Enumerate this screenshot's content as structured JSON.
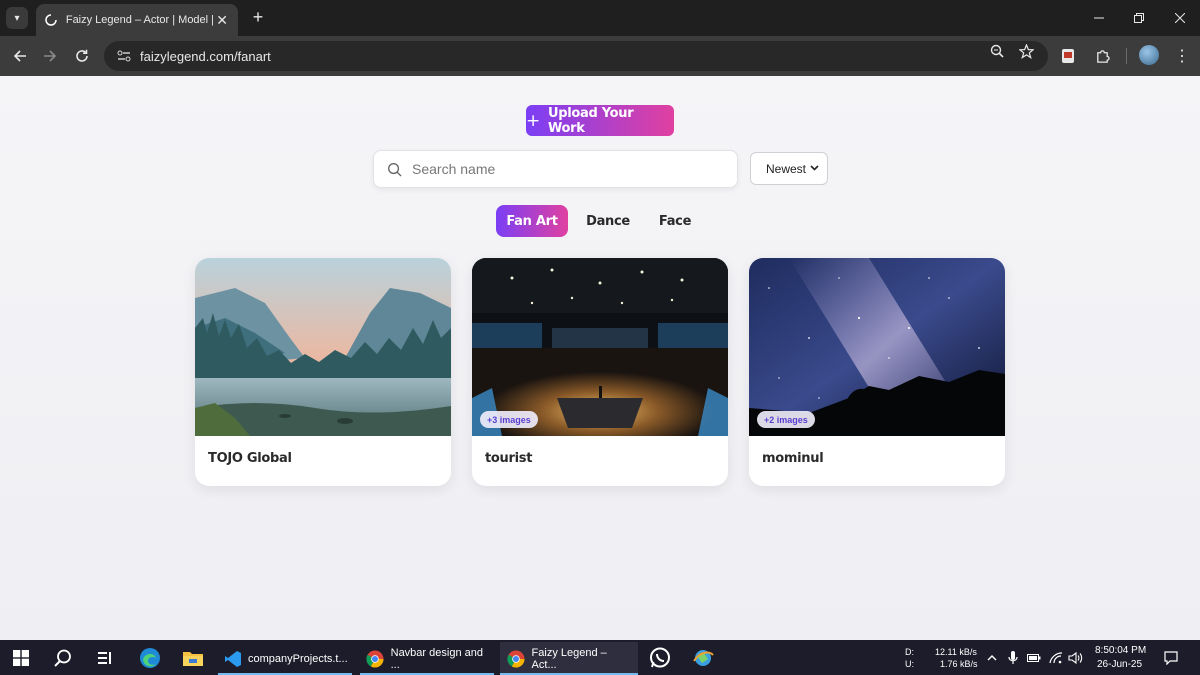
{
  "browser": {
    "tab_title": "Faizy Legend – Actor | Model | I",
    "url": "faizylegend.com/fanart",
    "new_tab_label": "+",
    "close_tab_label": "✕"
  },
  "page": {
    "upload_button": "Upload Your Work",
    "search": {
      "placeholder": "Search name",
      "value": ""
    },
    "sort": {
      "selected": "Newest"
    },
    "tabs": [
      {
        "label": "Fan Art",
        "active": true
      },
      {
        "label": "Dance",
        "active": false
      },
      {
        "label": "Face",
        "active": false
      }
    ],
    "cards": [
      {
        "name": "TOJO Global",
        "badge": "",
        "image": "mountain-landscape"
      },
      {
        "name": "tourist",
        "badge": "+3 images",
        "image": "conference-hall"
      },
      {
        "name": "mominul",
        "badge": "+2 images",
        "image": "milky-way-night-sky"
      }
    ]
  },
  "taskbar": {
    "apps": [
      {
        "label": "companyProjects.t..."
      },
      {
        "label": "Navbar design and ..."
      },
      {
        "label": "Faizy Legend – Act..."
      }
    ],
    "network": {
      "down_label": "D:",
      "up_label": "U:",
      "down": "12.11 kB/s",
      "up": "1.76 kB/s"
    },
    "time": "8:50:04 PM",
    "date": "26-Jun-25"
  },
  "colors": {
    "accent_start": "#7b3ff5",
    "accent_end": "#e040a0",
    "badge_text": "#5a3fd0"
  }
}
